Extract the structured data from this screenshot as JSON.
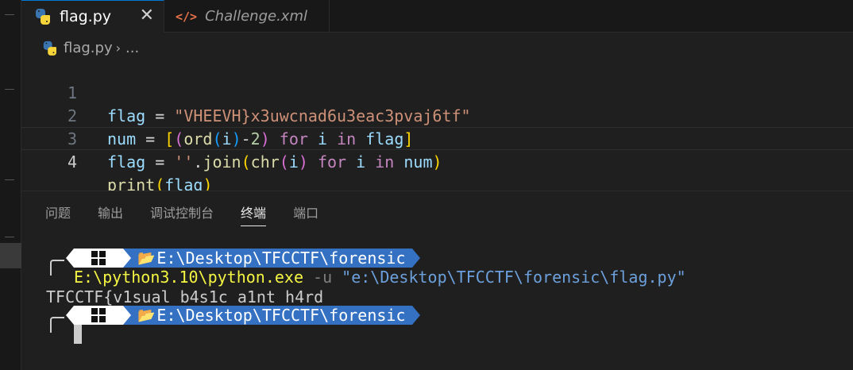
{
  "tabs": [
    {
      "label": "flag.py",
      "icon": "python-icon",
      "active": true,
      "close": "✕"
    },
    {
      "label": "Challenge.xml",
      "icon": "xml-icon",
      "glyph": "</>",
      "active": false
    }
  ],
  "breadcrumb": {
    "file": "flag.py",
    "separator": "›",
    "more": "..."
  },
  "editor": {
    "line_numbers": [
      "1",
      "2",
      "3",
      "4"
    ],
    "lines": [
      "flag = \"VHEEVH}x3uwcnad6u3eac3pvaj6tf\"",
      "num = [(ord(i)-2) for i in flag]",
      "flag = ''.join(chr(i) for i in num)",
      "print(flag)"
    ],
    "current_line": 4
  },
  "panel": {
    "tabs": [
      "问题",
      "输出",
      "调试控制台",
      "终端",
      "端口"
    ],
    "active_tab": "终端"
  },
  "terminal": {
    "prompt_path": "E:\\Desktop\\TFCCTF\\forensic",
    "folder_glyph": "📂",
    "command_exe": "E:\\python3.10\\python.exe",
    "command_flag": "-u",
    "command_arg": "\"e:\\Desktop\\TFCCTF\\forensic\\flag.py\"",
    "output": "TFCCTF{v1sual_b4s1c_a1nt_h4rd"
  },
  "colors": {
    "accent": "#0078d4",
    "prompt_segment": "#3471c2",
    "exe_yellow": "#f5f543"
  }
}
